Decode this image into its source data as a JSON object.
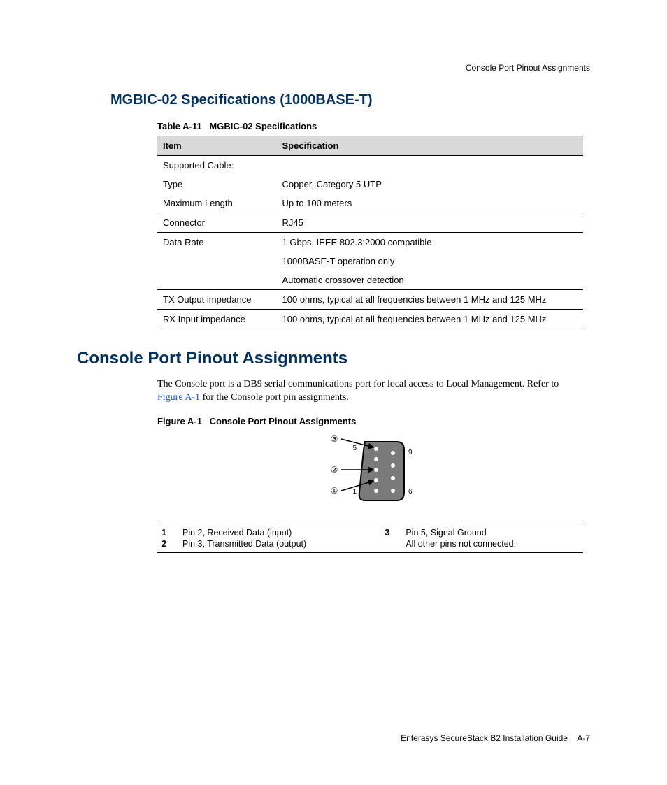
{
  "header": {
    "running_head": "Console Port Pinout Assignments"
  },
  "section1": {
    "heading": "MGBIC-02 Specifications (1000BASE-T)",
    "table_caption_label": "Table A-11",
    "table_caption_title": "MGBIC-02 Specifications",
    "columns": {
      "c1": "Item",
      "c2": "Specification"
    },
    "rows": {
      "r1": {
        "item": "Supported Cable:",
        "spec": ""
      },
      "r2": {
        "item": "Type",
        "spec": "Copper, Category 5 UTP"
      },
      "r3": {
        "item": "Maximum Length",
        "spec": "Up to 100 meters"
      },
      "r4": {
        "item": "Connector",
        "spec": "RJ45"
      },
      "r5": {
        "item": "Data Rate",
        "spec": "1 Gbps, IEEE 802.3:2000 compatible"
      },
      "r5b": {
        "item": "",
        "spec": "1000BASE-T operation only"
      },
      "r5c": {
        "item": "",
        "spec": "Automatic crossover detection"
      },
      "r6": {
        "item": "TX Output impedance",
        "spec": "100 ohms, typical at all frequencies between 1 MHz and 125 MHz"
      },
      "r7": {
        "item": "RX Input impedance",
        "spec": "100 ohms, typical at all frequencies between 1 MHz and 125 MHz"
      }
    }
  },
  "section2": {
    "heading": "Console Port Pinout Assignments",
    "body_pre": "The Console port is a DB9 serial communications port for local access to Local Management. Refer to ",
    "body_link": "Figure A-1",
    "body_post": " for the Console port pin assignments.",
    "figure_caption_label": "Figure A-1",
    "figure_caption_title": "Console Port Pinout Assignments",
    "connector": {
      "call3": "③",
      "call2": "②",
      "call1": "①",
      "pin5": "5",
      "pin9": "9",
      "pin1": "1",
      "pin6": "6"
    },
    "legend": {
      "n1": "1",
      "t1": "Pin 2, Received Data (input)",
      "n2": "2",
      "t2": "Pin 3, Transmitted Data (output)",
      "n3": "3",
      "t3": "Pin 5, Signal Ground",
      "t4": "All other pins not connected."
    }
  },
  "footer": {
    "book": "Enterasys SecureStack B2 Installation Guide",
    "page": "A-7"
  }
}
